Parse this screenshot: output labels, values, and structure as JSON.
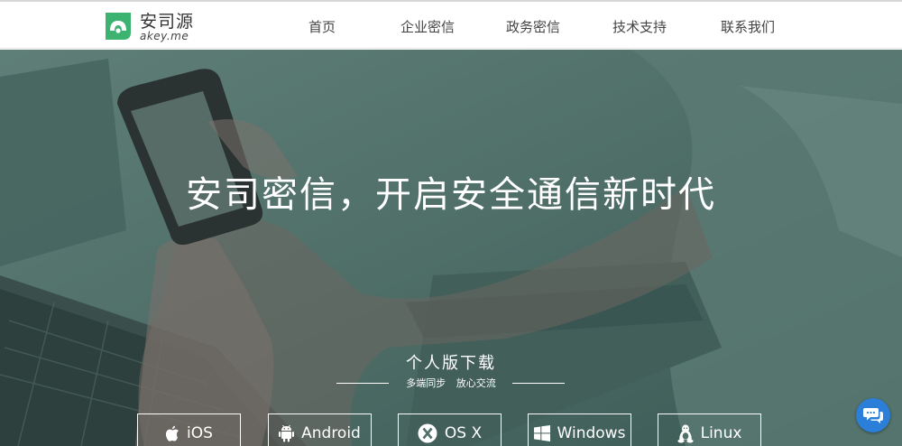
{
  "brand": {
    "name": "安司源",
    "domain": "akey.me",
    "color": "#3cb371"
  },
  "nav": {
    "items": [
      "首页",
      "企业密信",
      "政务密信",
      "技术支持",
      "联系我们"
    ]
  },
  "hero": {
    "title": "安司密信，开启安全通信新时代",
    "download": {
      "title": "个人版下载",
      "subtitle": [
        "多端同步",
        "放心交流"
      ],
      "platforms": [
        {
          "label": "iOS",
          "icon": "apple-icon"
        },
        {
          "label": "Android",
          "icon": "android-icon"
        },
        {
          "label": "OS X",
          "icon": "osx-icon"
        },
        {
          "label": "Windows",
          "icon": "windows-icon"
        },
        {
          "label": "Linux",
          "icon": "linux-icon"
        }
      ]
    }
  },
  "chat": {
    "icon": "chat-icon",
    "color": "#2c7fd9"
  }
}
